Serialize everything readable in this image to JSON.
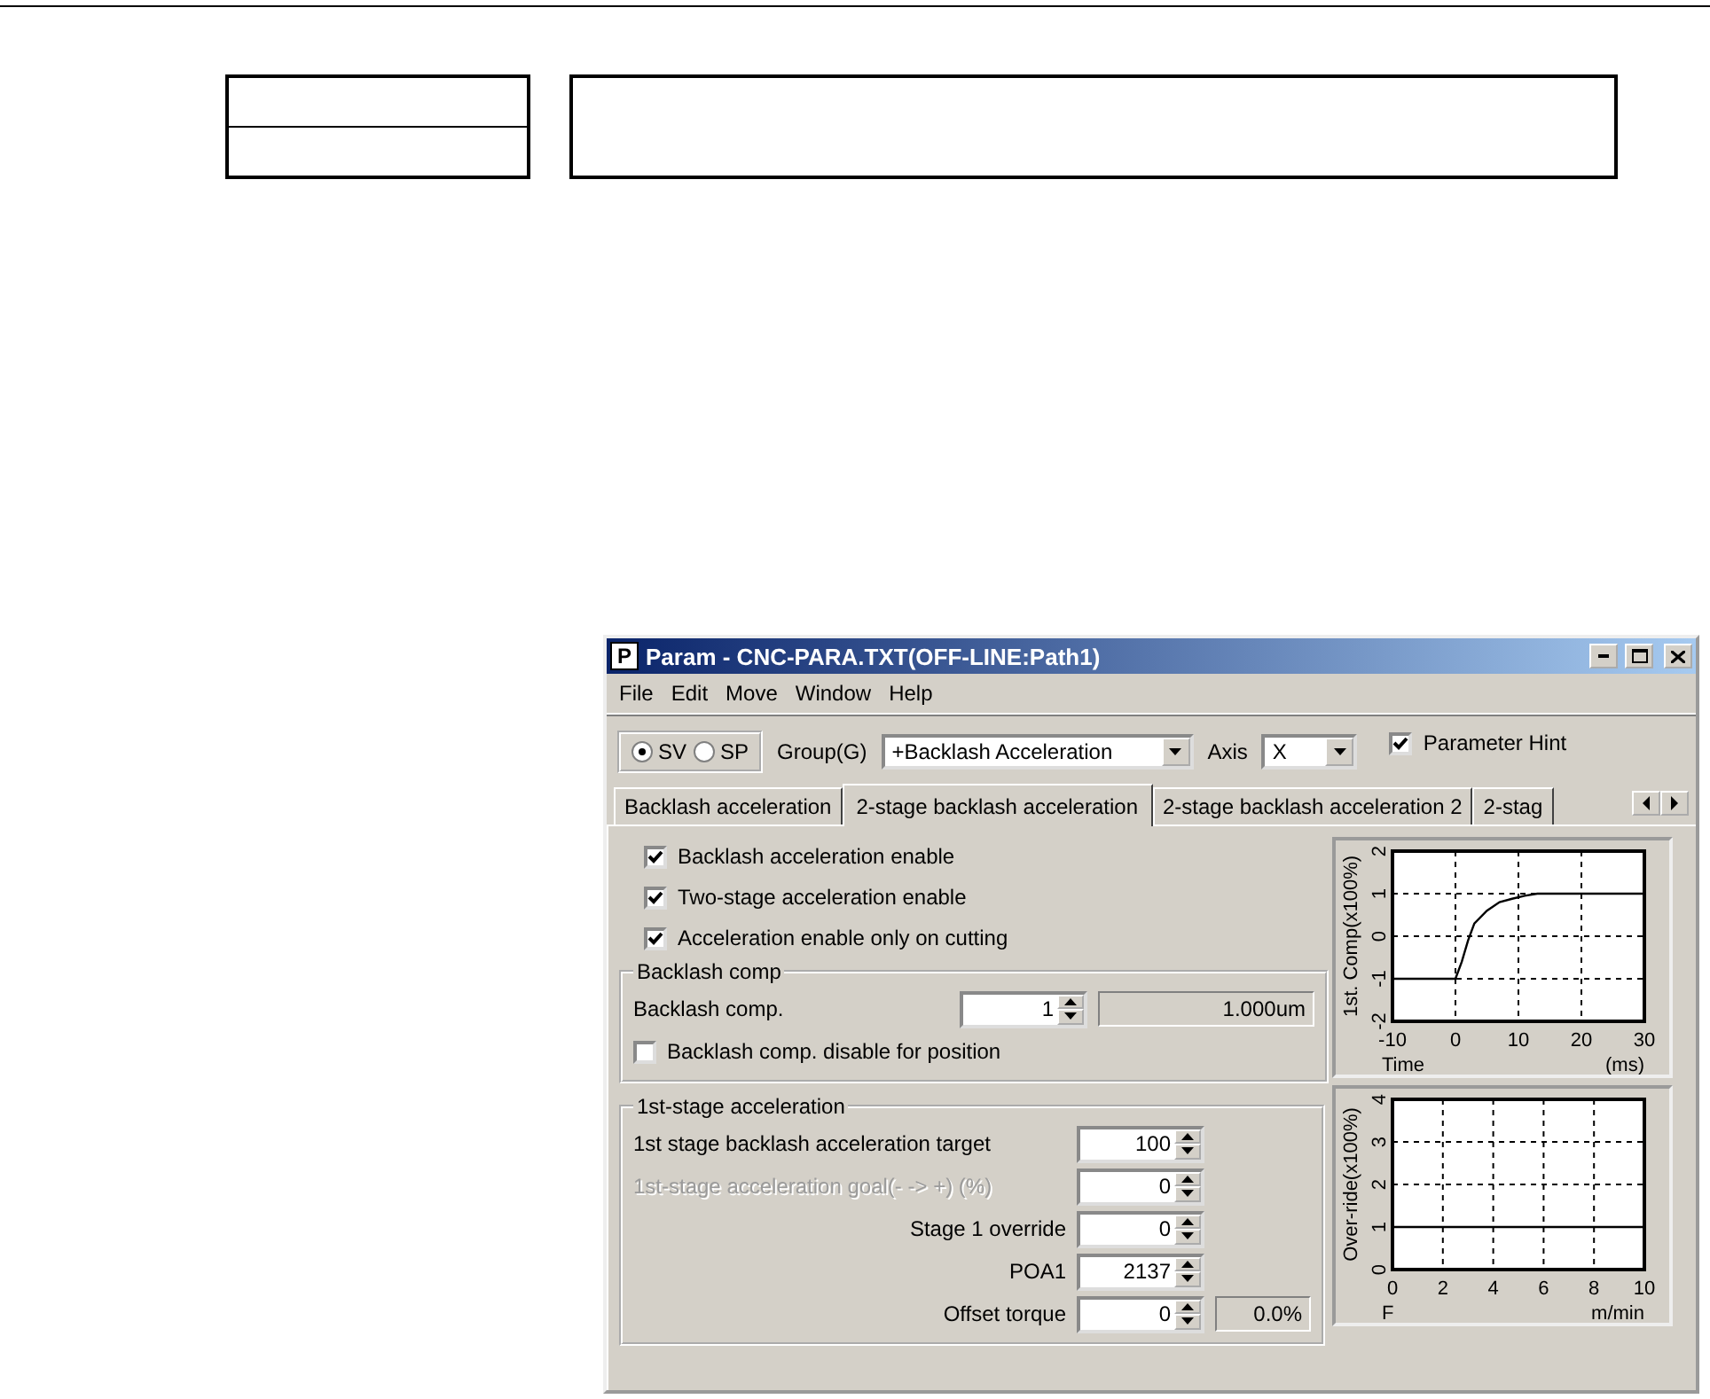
{
  "window": {
    "title": "Param - CNC-PARA.TXT(OFF-LINE:Path1)",
    "app_icon": "P"
  },
  "menu": [
    "File",
    "Edit",
    "Move",
    "Window",
    "Help"
  ],
  "toolbar": {
    "modes": [
      {
        "label": "SV",
        "selected": true
      },
      {
        "label": "SP",
        "selected": false
      }
    ],
    "group": {
      "label": "Group(G)",
      "value": "+Backlash Acceleration"
    },
    "axis": {
      "label": "Axis",
      "value": "X"
    },
    "hint": {
      "label": "Parameter Hint",
      "checked": true
    }
  },
  "tabs": [
    {
      "label": "Backlash acceleration",
      "selected": false
    },
    {
      "label": "2-stage backlash acceleration",
      "selected": true
    },
    {
      "label": "2-stage backlash acceleration 2",
      "selected": false
    },
    {
      "label": "2-stag",
      "selected": false
    }
  ],
  "options": [
    {
      "label": "Backlash acceleration enable",
      "checked": true
    },
    {
      "label": "Two-stage acceleration enable",
      "checked": true
    },
    {
      "label": "Acceleration enable only on cutting",
      "checked": true
    }
  ],
  "groups": [
    {
      "title": "Backlash comp",
      "rows": [
        {
          "kind": "spinner",
          "label": "Backlash comp.",
          "value": "1",
          "readout": "1.000um",
          "disabled": false
        },
        {
          "kind": "checkbox",
          "label": "Backlash comp. disable for position",
          "checked": false
        }
      ]
    },
    {
      "title": "1st-stage acceleration",
      "rows": [
        {
          "kind": "spinner",
          "label": "1st stage backlash acceleration target",
          "value": "100",
          "disabled": false
        },
        {
          "kind": "spinner",
          "label": "1st-stage acceleration goal(- -> +) (%)",
          "value": "0",
          "disabled": true
        },
        {
          "kind": "spinner",
          "label": "Stage 1 override",
          "value": "0",
          "disabled": false
        },
        {
          "kind": "spinner",
          "label": "POA1",
          "value": "2137",
          "disabled": false
        },
        {
          "kind": "spinner",
          "label": "Offset torque",
          "value": "0",
          "readout": "0.0%",
          "disabled": false
        }
      ]
    }
  ],
  "charts": [
    {
      "unit": "(ms)",
      "chart_data": {
        "type": "line",
        "xlabel": "Time",
        "ylabel": "1st. Comp(x100%)",
        "xlim": [
          -10,
          30
        ],
        "ylim": [
          -2,
          2
        ],
        "xticks": [
          -10,
          0,
          10,
          20,
          30
        ],
        "yticks": [
          -2,
          -1,
          0,
          1,
          2
        ],
        "grid": true,
        "series": [
          {
            "color": "#000000",
            "line_style": "solid",
            "x": [
              -10,
              0,
              1,
              2,
              3,
              5,
              7,
              9,
              11,
              13,
              30
            ],
            "values": [
              -1,
              -1,
              -0.6,
              -0.1,
              0.3,
              0.6,
              0.8,
              0.88,
              0.95,
              1,
              1
            ]
          }
        ]
      }
    },
    {
      "unit": "m/min",
      "chart_data": {
        "type": "line",
        "xlabel": "F",
        "ylabel": "Over-ride(x100%)",
        "xlim": [
          0,
          10
        ],
        "ylim": [
          0,
          4
        ],
        "xticks": [
          0,
          2,
          4,
          6,
          8,
          10
        ],
        "yticks": [
          0,
          1,
          2,
          3,
          4
        ],
        "grid": true,
        "series": [
          {
            "color": "#000000",
            "line_style": "solid",
            "x": [
              0,
              10
            ],
            "values": [
              1,
              1
            ]
          }
        ]
      }
    }
  ]
}
